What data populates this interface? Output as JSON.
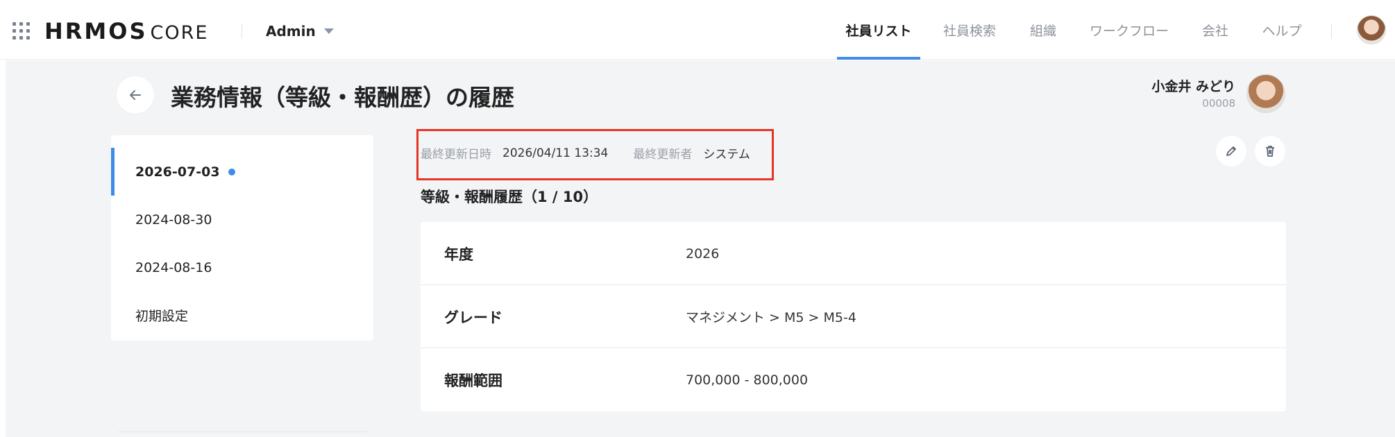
{
  "header": {
    "logo_main": "HRMOS",
    "logo_sub": "CORE",
    "role": "Admin",
    "nav": [
      {
        "label": "社員リスト",
        "active": true
      },
      {
        "label": "社員検索",
        "active": false
      },
      {
        "label": "組織",
        "active": false
      },
      {
        "label": "ワークフロー",
        "active": false
      },
      {
        "label": "会社",
        "active": false
      },
      {
        "label": "ヘルプ",
        "active": false
      }
    ]
  },
  "page": {
    "title": "業務情報（等級・報酬歴）の履歴",
    "user_name": "小金井 みどり",
    "user_id": "00008"
  },
  "history": {
    "items": [
      {
        "label": "2026-07-03",
        "active": true
      },
      {
        "label": "2024-08-30",
        "active": false
      },
      {
        "label": "2024-08-16",
        "active": false
      },
      {
        "label": "初期設定",
        "active": false
      }
    ]
  },
  "meta": {
    "updated_at_label": "最終更新日時",
    "updated_at_value": "2026/04/11 13:34",
    "updated_by_label": "最終更新者",
    "updated_by_value": "システム"
  },
  "section": {
    "title": "等級・報酬履歴（1 / 10）"
  },
  "detail": {
    "rows": [
      {
        "key": "年度",
        "value": "2026"
      },
      {
        "key": "グレード",
        "value": "マネジメント > M5 > M5-4"
      },
      {
        "key": "報酬範囲",
        "value": "700,000 - 800,000"
      }
    ]
  },
  "colors": {
    "accent": "#3f8ce8",
    "highlight": "#e53425",
    "background": "#f3f4f6"
  },
  "icons": {
    "apps": "apps-grid-icon",
    "dropdown": "caret-down-icon",
    "back": "arrow-left-icon",
    "edit": "pencil-icon",
    "delete": "trash-icon",
    "active_marker": "dot-icon"
  }
}
